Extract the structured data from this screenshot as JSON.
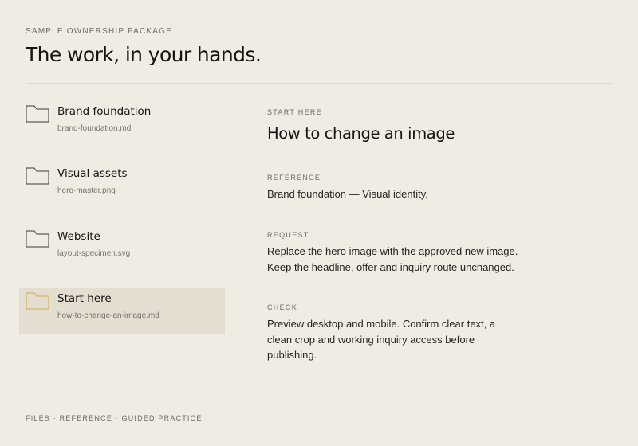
{
  "header": {
    "eyebrow": "SAMPLE OWNERSHIP PACKAGE",
    "title": "The work, in your hands."
  },
  "files": [
    {
      "name": "Brand foundation",
      "path": "brand-foundation.md",
      "icon": "folder-icon",
      "active": false
    },
    {
      "name": "Visual assets",
      "path": "hero-master.png",
      "icon": "folder-icon",
      "active": false
    },
    {
      "name": "Website",
      "path": "layout-specimen.svg",
      "icon": "folder-icon",
      "active": false
    },
    {
      "name": "Start here",
      "path": "how-to-change-an-image.md",
      "icon": "folder-icon",
      "active": true
    }
  ],
  "document": {
    "eyebrow": "START HERE",
    "title": "How to change an image",
    "sections": [
      {
        "label": "REFERENCE",
        "lines": [
          "Brand foundation — Visual identity."
        ]
      },
      {
        "label": "REQUEST",
        "lines": [
          "Replace the hero image with the approved new image.",
          "Keep the headline, offer and inquiry route unchanged."
        ]
      },
      {
        "label": "CHECK",
        "lines": [
          "Preview desktop and mobile. Confirm clear text, a",
          "clean crop and working inquiry access before",
          "publishing."
        ]
      }
    ]
  },
  "footer": {
    "text": "FILES · REFERENCE · GUIDED PRACTICE"
  },
  "colors": {
    "background": "#f0ece4",
    "active_row": "#e4ded1",
    "folder_stroke": "#3b3833",
    "folder_active_stroke": "#d1ac48"
  }
}
